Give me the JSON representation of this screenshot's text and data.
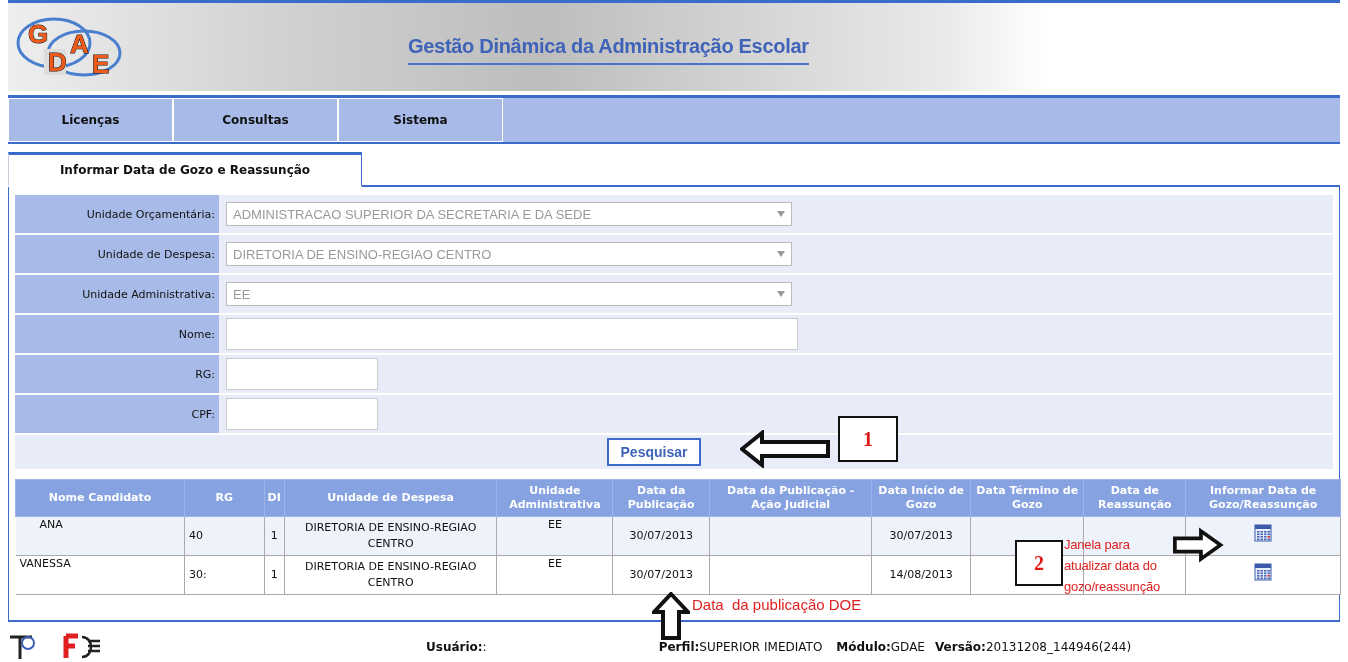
{
  "header": {
    "logo_letters": [
      "G",
      "D",
      "A",
      "E"
    ],
    "title": "Gestão Dinâmica da Administração Escolar"
  },
  "menu": [
    {
      "label": "Licenças"
    },
    {
      "label": "Consultas"
    },
    {
      "label": "Sistema"
    }
  ],
  "tabs": [
    {
      "label": "Informar Data de Gozo e Reassunção",
      "selected": true
    }
  ],
  "form": {
    "fields": [
      {
        "kind": "select",
        "label": "Unidade Orçamentária:",
        "value": "ADMINISTRACAO SUPERIOR DA SECRETARIA E DA SEDE",
        "disabled": true
      },
      {
        "kind": "select",
        "label": "Unidade de Despesa:",
        "value": "DIRETORIA DE ENSINO-REGIAO CENTRO",
        "disabled": true
      },
      {
        "kind": "select",
        "label": "Unidade Administrativa:",
        "value": "EE",
        "disabled": true
      },
      {
        "kind": "wide",
        "label": "Nome:"
      },
      {
        "kind": "short",
        "label": "RG:"
      },
      {
        "kind": "short",
        "label": "CPF:"
      }
    ],
    "search_button": "Pesquisar"
  },
  "table": {
    "columns": [
      "Nome Candidato",
      "RG",
      "DI",
      "Unidade de Despesa",
      "Unidade Administrativa",
      "Data da Publicação",
      "Data da Publicação - Ação Judicial",
      "Data Início de Gozo",
      "Data Término de Gozo",
      "Data de Reassunção",
      "Informar Data de Gozo/Reassunção"
    ],
    "rows": [
      {
        "nome": "ANA",
        "rg": "40",
        "di": "1",
        "unidade_despesa": "DIRETORIA DE ENSINO-REGIAO CENTRO",
        "unidade_administrativa": "EE",
        "data_publicacao": "30/07/2013",
        "data_inicio_gozo": "30/07/2013"
      },
      {
        "nome": "VANESSA",
        "rg": "30:",
        "di": "1",
        "unidade_despesa": "DIRETORIA DE ENSINO-REGIAO CENTRO",
        "unidade_administrativa": "EE",
        "data_publicacao": "30/07/2013",
        "data_inicio_gozo": "14/08/2013"
      }
    ]
  },
  "annotations": [
    {
      "kind": "callout",
      "number": "1"
    },
    {
      "kind": "pointer",
      "note": "Data  da publicação DOE"
    },
    {
      "kind": "callout",
      "number": "2",
      "note": "Janela para atualizar data do gozo/reassunção"
    }
  ],
  "footer": {
    "user_label": "Usuário:",
    "user_value": ":",
    "items": [
      {
        "label": "Perfil:",
        "value": "SUPERIOR IMEDIATO"
      },
      {
        "label": "Módulo:",
        "value": "GDAE"
      },
      {
        "label": "Versão:",
        "value": "20131208_144946(244)"
      }
    ]
  }
}
